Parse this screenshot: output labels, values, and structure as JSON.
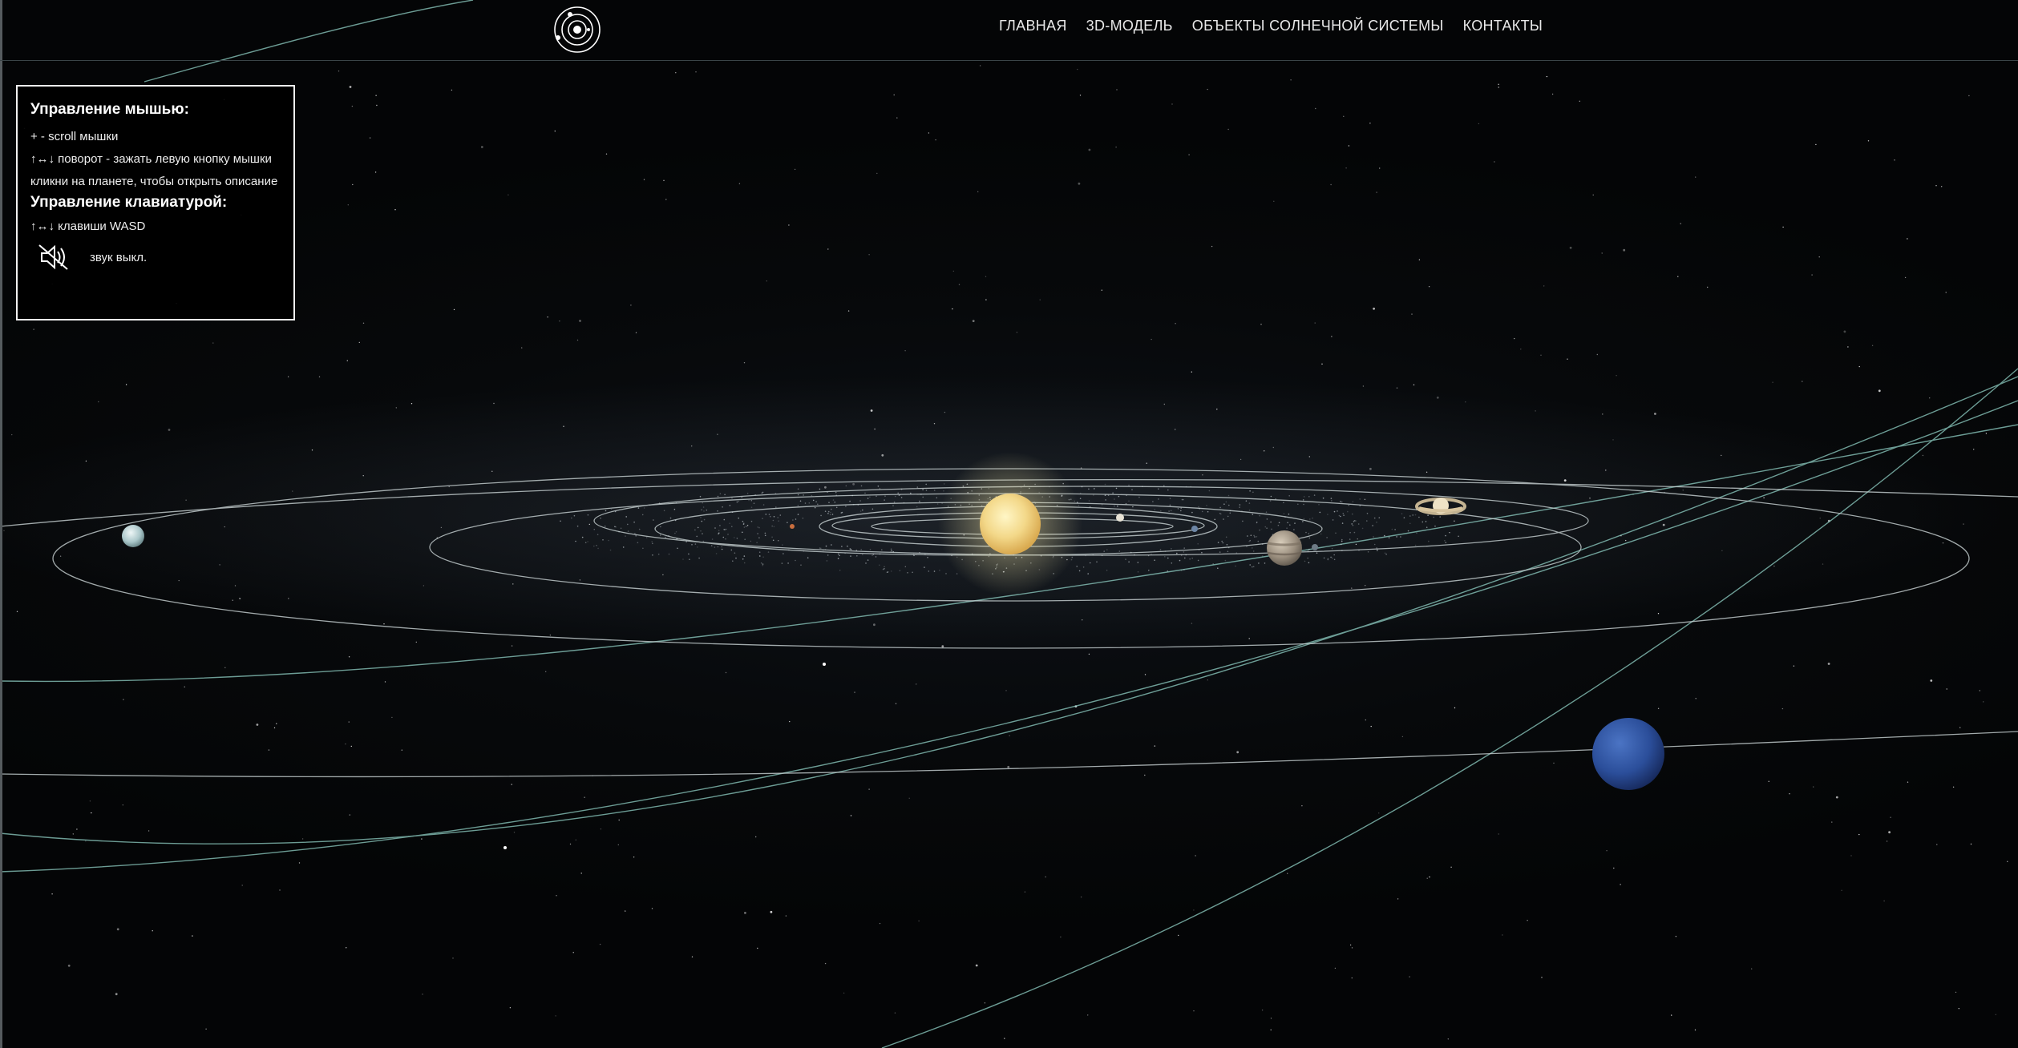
{
  "header": {
    "logo_icon": "solar-system-logo-icon",
    "nav": [
      {
        "label": "ГЛАВНАЯ"
      },
      {
        "label": "3D-МОДЕЛЬ"
      },
      {
        "label": "ОБЪЕКТЫ СОЛНЕЧНОЙ СИСТЕМЫ"
      },
      {
        "label": "КОНТАКТЫ"
      }
    ]
  },
  "controls": {
    "mouse_heading": "Управление мышью:",
    "mouse_zoom": "+ - scroll мышки",
    "mouse_rotate": "↑↔↓ поворот - зажать левую кнопку мышки",
    "mouse_click": "кликни на планете, чтобы открыть описание",
    "keyboard_heading": "Управление клавиатурой:",
    "keyboard_keys": "↑↔↓ клавиши WASD",
    "sound_icon": "sound-off-icon",
    "sound_label": "звук выкл."
  },
  "scene": {
    "objects": [
      "sun",
      "mercury",
      "venus",
      "earth",
      "mars",
      "jupiter",
      "saturn",
      "uranus",
      "neptune"
    ],
    "colors": {
      "background": "#050607",
      "orbit_line": "#c9d3d4",
      "comet_line": "#8fcfc4",
      "sun": "#f6dc8a",
      "neptune": "#2c4f9a",
      "uranus": "#b9d3d6",
      "jupiter": "#a99c8b",
      "saturn": "#e2d4b5"
    }
  }
}
